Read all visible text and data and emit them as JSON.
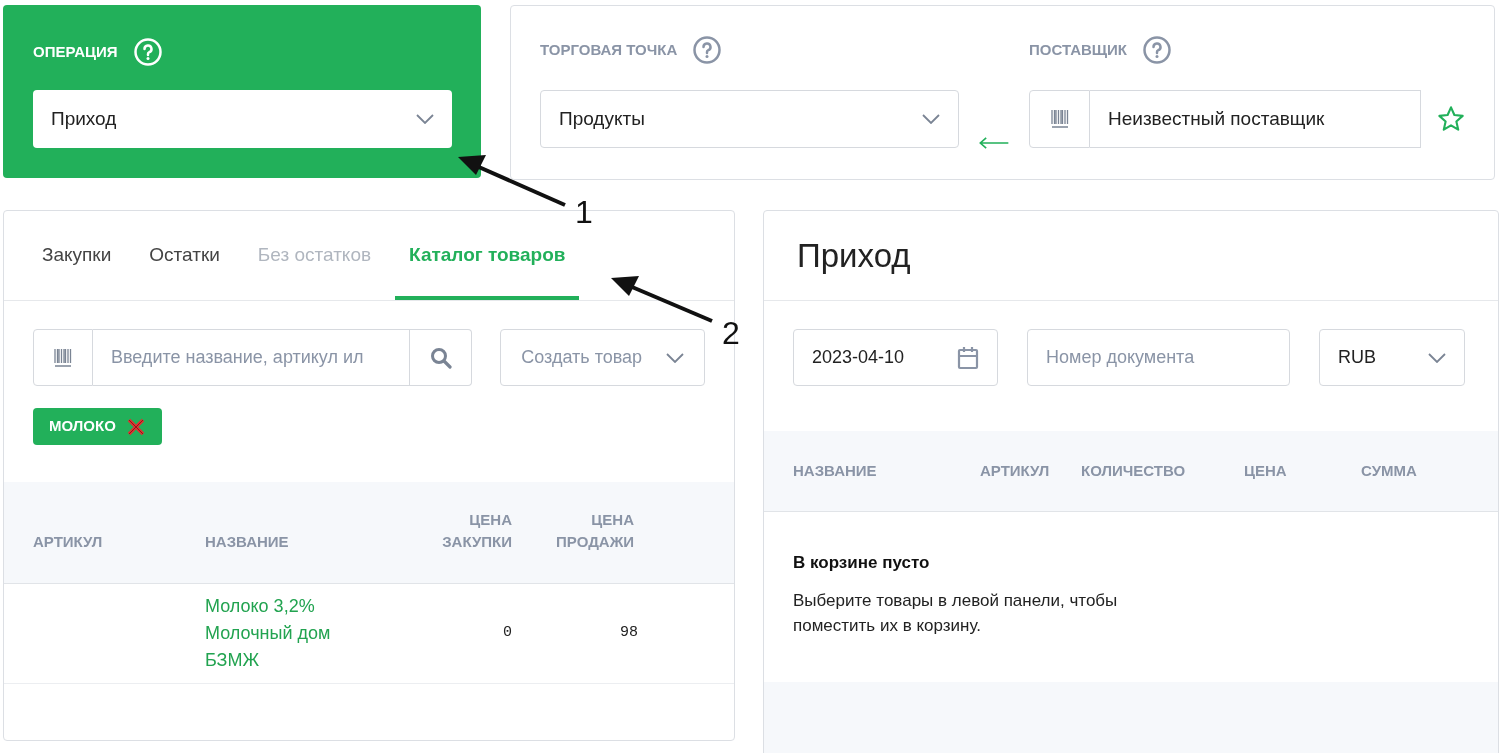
{
  "operation": {
    "label": "ОПЕРАЦИЯ",
    "value": "Приход"
  },
  "store": {
    "label": "ТОРГОВАЯ ТОЧКА",
    "value": "Продукты"
  },
  "supplier": {
    "label": "ПОСТАВЩИК",
    "value": "Неизвестный поставщик"
  },
  "tabs": [
    {
      "label": "Закупки",
      "selected": false,
      "disabled": false
    },
    {
      "label": "Остатки",
      "selected": false,
      "disabled": false
    },
    {
      "label": "Без остатков",
      "selected": false,
      "disabled": true
    },
    {
      "label": "Каталог товаров",
      "selected": true,
      "disabled": false
    }
  ],
  "search": {
    "placeholder": "Введите название, артикул ил"
  },
  "create_button": "Создать товар",
  "filter_chips": [
    {
      "label": "МОЛОКО"
    }
  ],
  "catalog_table": {
    "columns": [
      "АРТИКУЛ",
      "НАЗВАНИЕ",
      "ЦЕНА ЗАКУПКИ",
      "ЦЕНА ПРОДАЖИ"
    ],
    "rows": [
      {
        "name": "Молоко 3,2% Молочный дом БЗМЖ",
        "purchase_price": "0",
        "sale_price": "98"
      }
    ]
  },
  "document": {
    "title": "Приход",
    "date": "2023-04-10",
    "number_placeholder": "Номер документа",
    "currency": "RUB"
  },
  "cart_table": {
    "columns": [
      "НАЗВАНИЕ",
      "АРТИКУЛ",
      "КОЛИЧЕСТВО",
      "ЦЕНА",
      "СУММА"
    ],
    "empty_title": "В корзине пусто",
    "empty_text": "Выберите товары в левой панели, чтобы поместить их в корзину."
  },
  "annotations": [
    {
      "label": "1"
    },
    {
      "label": "2"
    }
  ]
}
